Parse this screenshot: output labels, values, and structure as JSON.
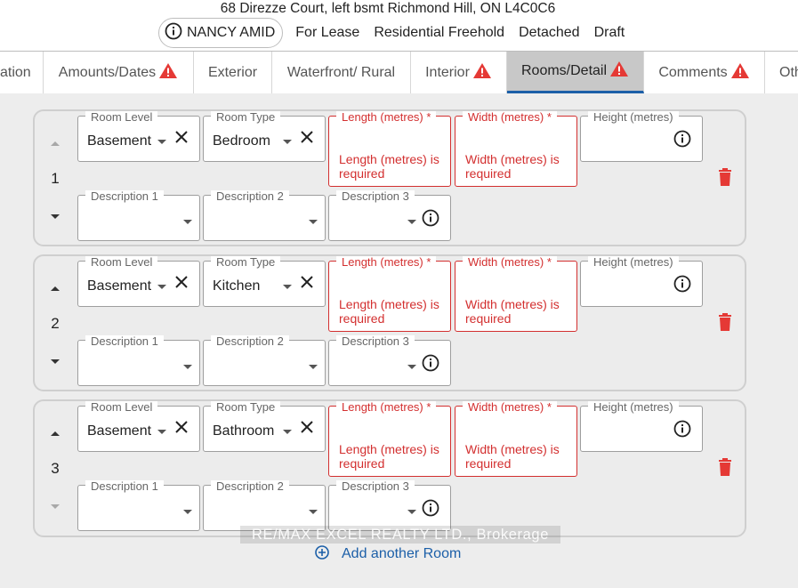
{
  "header": {
    "address": "68 Direzze Court, left bsmt Richmond Hill, ON L4C0C6",
    "agent": "NANCY AMID",
    "meta": [
      "For Lease",
      "Residential Freehold",
      "Detached",
      "Draft"
    ]
  },
  "tabs": [
    {
      "label": "ation",
      "warning": false
    },
    {
      "label": "Amounts/Dates",
      "warning": true
    },
    {
      "label": "Exterior",
      "warning": false
    },
    {
      "label": "Waterfront/ Rural",
      "warning": false
    },
    {
      "label": "Interior",
      "warning": true
    },
    {
      "label": "Rooms/Detail",
      "warning": true,
      "active": true
    },
    {
      "label": "Comments",
      "warning": true
    },
    {
      "label": "Oth",
      "warning": false
    }
  ],
  "field_labels": {
    "room_level": "Room Level",
    "room_type": "Room Type",
    "length": "Length (metres) *",
    "width": "Width (metres) *",
    "height": "Height (metres)",
    "description1": "Description 1",
    "description2": "Description 2",
    "description3": "Description 3"
  },
  "errors": {
    "length": "Length (metres) is required",
    "width": "Width (metres) is required"
  },
  "rooms": [
    {
      "number": "1",
      "level": "Basement",
      "type": "Bedroom"
    },
    {
      "number": "2",
      "level": "Basement",
      "type": "Kitchen"
    },
    {
      "number": "3",
      "level": "Basement",
      "type": "Bathroom"
    }
  ],
  "footer": {
    "brokerage": "RE/MAX EXCEL REALTY LTD., Brokerage",
    "add_room": "Add another Room"
  },
  "colors": {
    "accent": "#1c5fa8",
    "error": "#d32f2f",
    "warning": "#e53935"
  }
}
